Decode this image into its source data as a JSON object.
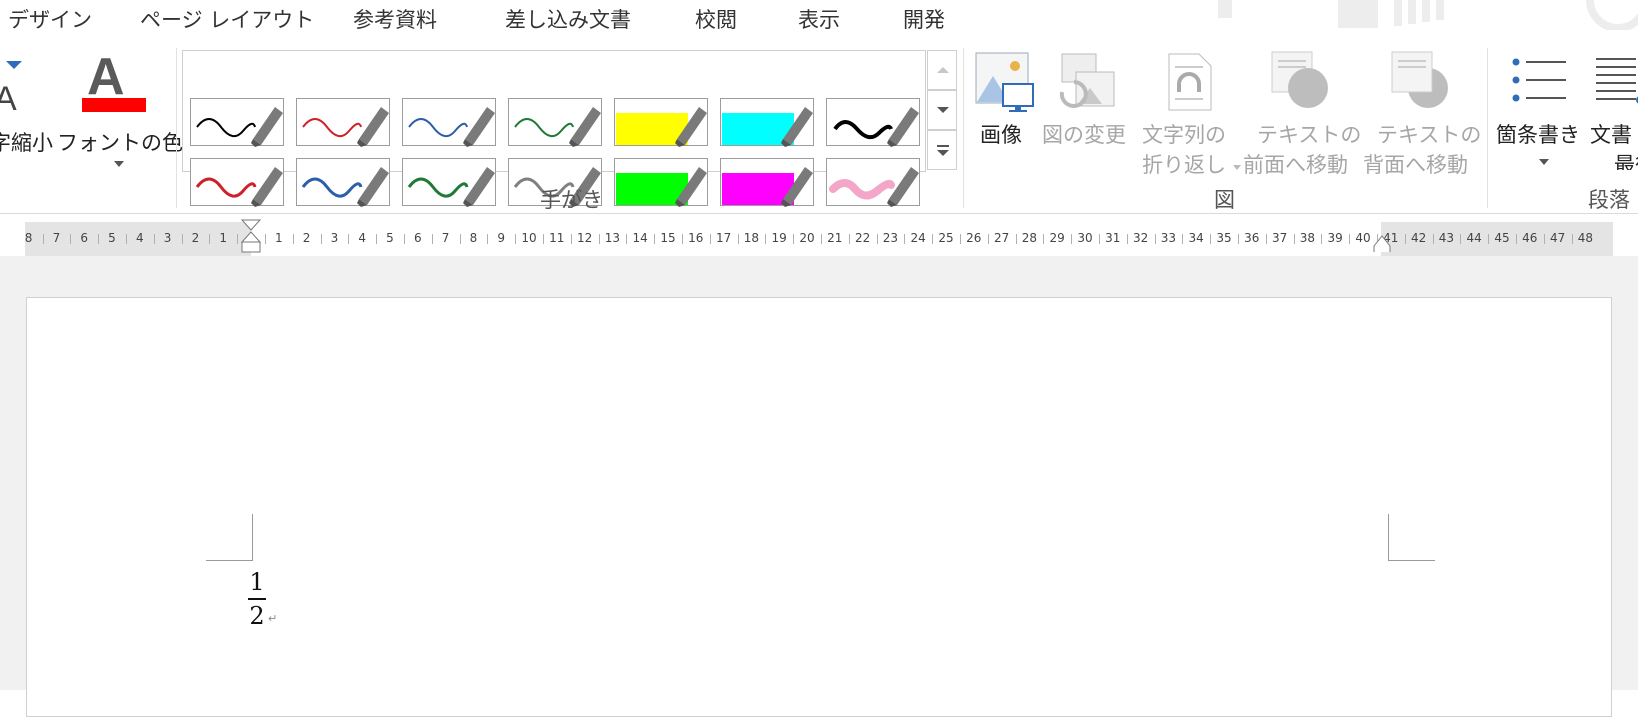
{
  "tabs": [
    "デザイン",
    "ページ レイアウト",
    "参考資料",
    "差し込み文書",
    "校閲",
    "表示",
    "開発"
  ],
  "font_group": {
    "shrink_label": "字縮小",
    "font_color_label": "フォントの色",
    "font_color": "#ff0000"
  },
  "ink_group": {
    "label": "手がき",
    "pens": [
      {
        "name": "black-pen",
        "color": "#000000",
        "type": "pen"
      },
      {
        "name": "red-pen",
        "color": "#d0202a",
        "type": "pen"
      },
      {
        "name": "blue-pen",
        "color": "#2d5fa8",
        "type": "pen"
      },
      {
        "name": "green-pen",
        "color": "#1e7a34",
        "type": "pen"
      },
      {
        "name": "yellow-highlighter",
        "color": "#ffff00",
        "type": "highlighter"
      },
      {
        "name": "cyan-highlighter",
        "color": "#00ffff",
        "type": "highlighter"
      },
      {
        "name": "black-thick-pen",
        "color": "#000000",
        "type": "thick"
      },
      {
        "name": "red-pen-2",
        "color": "#d0202a",
        "type": "pen2"
      },
      {
        "name": "blue-pen-2",
        "color": "#2d5fa8",
        "type": "pen2"
      },
      {
        "name": "green-pen-2",
        "color": "#1e7a34",
        "type": "pen2"
      },
      {
        "name": "gray-pen",
        "color": "#808080",
        "type": "pen2"
      },
      {
        "name": "green-highlighter",
        "color": "#00ff00",
        "type": "highlighter"
      },
      {
        "name": "magenta-highlighter",
        "color": "#ff00ff",
        "type": "highlighter"
      },
      {
        "name": "pink-pen",
        "color": "#f4a6c8",
        "type": "pink"
      }
    ]
  },
  "picture_group": {
    "label": "図",
    "image": "画像",
    "change_picture": "図の変更",
    "wrap_text_1": "文字列の",
    "wrap_text_2": "折り返し",
    "bring_forward_1": "テキストの",
    "bring_forward_2": "前面へ移動",
    "send_backward_1": "テキストの",
    "send_backward_2": "背面へ移動"
  },
  "paragraph_group": {
    "label": "段落",
    "bullets": "箇条書き",
    "doc_end_1": "文書",
    "doc_end_2": "最後"
  },
  "ruler": {
    "left_numbers": [
      "8",
      "7",
      "6",
      "5",
      "4",
      "3",
      "2",
      "1"
    ],
    "right_numbers": [
      "1",
      "2",
      "3",
      "4",
      "5",
      "6",
      "7",
      "8",
      "9",
      "10",
      "11",
      "12",
      "13",
      "14",
      "15",
      "16",
      "17",
      "18",
      "19",
      "20",
      "21",
      "22",
      "23",
      "24",
      "25",
      "26",
      "27",
      "28",
      "29",
      "30",
      "31",
      "32",
      "33",
      "34",
      "35",
      "36",
      "37",
      "38",
      "39",
      "40",
      "41",
      "42",
      "43",
      "44",
      "45",
      "46",
      "47",
      "48"
    ]
  },
  "document": {
    "numerator": "1",
    "denominator": "2",
    "paragraph_mark": "↵"
  }
}
